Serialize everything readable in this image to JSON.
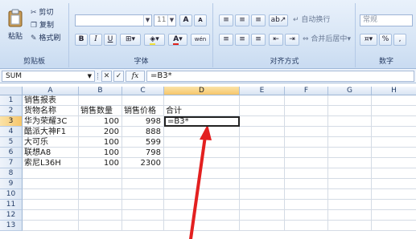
{
  "ribbon": {
    "clipboard": {
      "group": "剪贴板",
      "paste": "粘贴",
      "cut": "剪切",
      "copy": "复制",
      "format_painter": "格式刷"
    },
    "font": {
      "group": "字体",
      "size": "11",
      "grow": "A",
      "shrink": "A",
      "bold": "B",
      "italic": "I",
      "underline": "U",
      "font_color": "A",
      "phonetic": "wén"
    },
    "alignment": {
      "group": "对齐方式",
      "wrap_text": "自动换行",
      "merge_center": "合并后居中"
    },
    "number": {
      "group": "数字",
      "format": "常规",
      "percent": "%"
    }
  },
  "formula_bar": {
    "name_box": "SUM",
    "fx": "fx",
    "formula": "=B3*"
  },
  "columns": [
    "A",
    "B",
    "C",
    "D",
    "E",
    "F",
    "G",
    "H"
  ],
  "rows": [
    "1",
    "2",
    "3",
    "4",
    "5",
    "6",
    "7",
    "8",
    "9",
    "10",
    "11",
    "12",
    "13"
  ],
  "cells": {
    "A1": "销售报表",
    "A2": "货物名称",
    "B2": "销售数量",
    "C2": "销售价格",
    "D2": "合计",
    "A3": "华为荣耀3C",
    "B3": "100",
    "C3": "998",
    "D3": "=B3*",
    "A4": "酷派大神F1",
    "B4": "200",
    "C4": "888",
    "A5": "大可乐",
    "B5": "100",
    "C5": "599",
    "A6": "联想A8",
    "B6": "100",
    "C6": "798",
    "A7": "索尼L36H",
    "B7": "100",
    "C7": "2300"
  },
  "active_cell": "D3",
  "colors": {
    "annotation_arrow": "#e32020",
    "active_header": "#f6c56a"
  }
}
